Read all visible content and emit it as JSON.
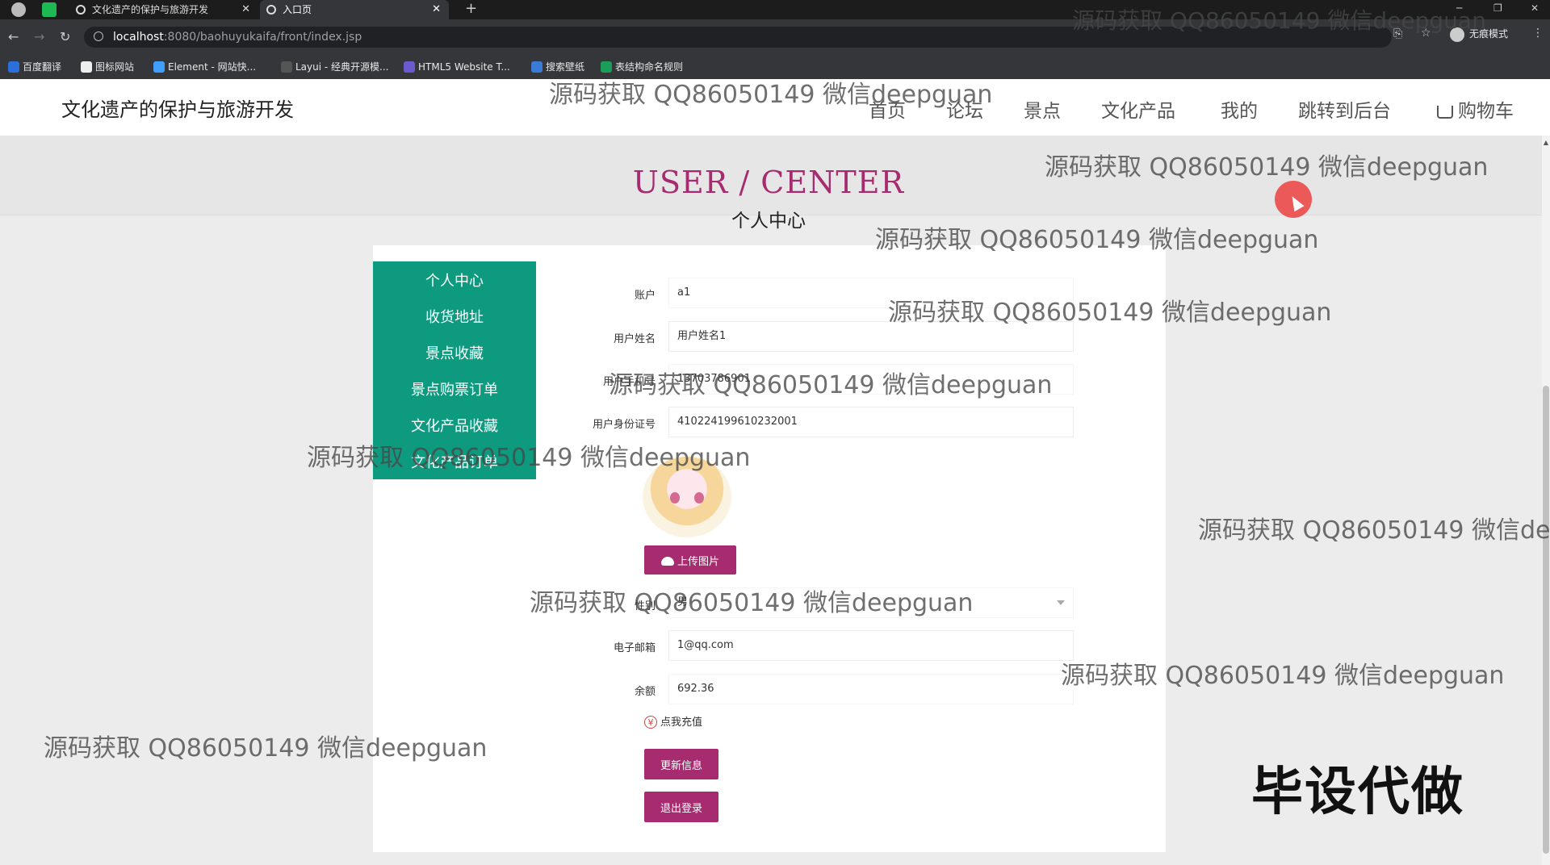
{
  "browser": {
    "tabs": [
      {
        "title": "文化遗产的保护与旅游开发"
      },
      {
        "title": "入口页"
      }
    ],
    "tab_close": "✕",
    "new_tab": "+",
    "url_host": "localhost",
    "url_path": ":8080/baohuyukaifa/front/index.jsp",
    "incognito_label": "无痕模式",
    "bookmarks": [
      "百度翻译",
      "图标网站",
      "Element - 网站快...",
      "Layui - 经典开源模...",
      "HTML5 Website T...",
      "搜索壁纸",
      "表结构命名规则"
    ]
  },
  "site": {
    "title": "文化遗产的保护与旅游开发",
    "nav": [
      "首页",
      "论坛",
      "景点",
      "文化产品",
      "我的",
      "跳转到后台",
      "购物车"
    ]
  },
  "hero": {
    "en": "USER / CENTER",
    "cn": "个人中心"
  },
  "sidebar": {
    "items": [
      "个人中心",
      "收货地址",
      "景点收藏",
      "景点购票订单",
      "文化产品收藏",
      "文化产品订单"
    ]
  },
  "form": {
    "account_label": "账户",
    "account_value": "a1",
    "name_label": "用户姓名",
    "name_value": "用户姓名1",
    "phone_label": "用户手机号",
    "phone_value": "13703786901",
    "idcard_label": "用户身份证号",
    "idcard_value": "410224199610232001",
    "upload_label": "上传图片",
    "gender_label": "性别",
    "gender_value": "男",
    "email_label": "电子邮箱",
    "email_value": "1@qq.com",
    "balance_label": "余额",
    "balance_value": "692.36",
    "recharge_label": "点我充值",
    "update_label": "更新信息",
    "logout_label": "退出登录"
  },
  "watermark": "源码获取 QQ86050149 微信deepguan",
  "watermark_cut": "源码获取 QQ86050149 微信dee",
  "stamp": "毕设代做",
  "colors": {
    "accent": "#a62b6f",
    "sidebar": "#0e9a7f",
    "cursor": "#ec4040"
  }
}
